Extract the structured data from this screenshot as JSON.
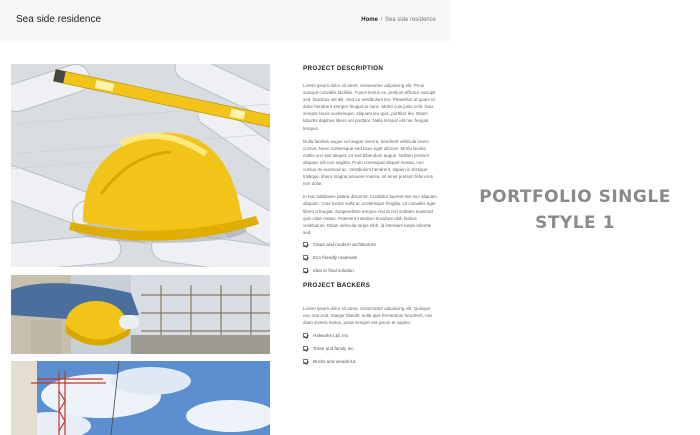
{
  "header": {
    "title": "Sea side residence",
    "breadcrumb": {
      "home": "Home",
      "separator": "/",
      "current": "Sea side residence"
    }
  },
  "images": [
    {
      "name": "hard-hat-on-blueprints-image"
    },
    {
      "name": "worker-holding-hard-hat-image"
    },
    {
      "name": "construction-crane-image"
    }
  ],
  "project_description": {
    "heading": "PROJECT DESCRIPTION",
    "paragraphs": [
      "Lorem ipsum dolor sit amet, consectetur adipiscing elit. Proin suscipit convallis facilisis. Fusce lectus ex, pretium efficitur suscipit sed, faucibus vel elit. Sed eu vestibulum leo. Phasellus at quam id dolor hendrerit semper feugiat at nunc. Morbi cuis justo velit. Duis semper lacus scelerisque, aliquam leo quis, porttitor leo. Etiam lobortis dapibus libero vel porttitor. Nulla tempor elit nec feugiat tempus.",
      "Nulla facilisis augue vel augue viverra, hendrerit vehicula lorem cursus. Nunc scelerisque sed risus eget ultrices. Morbi lacinia mollis orci sed aliquet. Ut sed bibendum augue. Nullam pretium aliquam elit non sagittis. Proin consequat aliquet massa, non cursus mi euismod ac. Vestibulum hendrerit, sapien in tristique tristique, libero magna posuere massa, sit amet pretium felis eros non dolor.",
      "In hac habitasse platea dictumst. Curabitur laoreet nisi nec aliquam aliquam. Cras luctus nulla ac scelerisque fringilla. Ut convallis eget libero a feugiat. Suspendisse tempus nisl at nisl sodales euismod quis vitae metus. Praesent interdum tincidunt nibh finibus vestibulum. Etiam vehicula turpis nibh, id interdum turpis lobortis sed."
    ],
    "features": [
      "Clean and modern architecture",
      "Eco friendly materials",
      "Idea to final solution"
    ]
  },
  "project_backers": {
    "heading": "PROJECT BACKERS",
    "paragraph": "Lorem ipsum dolor sit amet, consectetur adipiscing elit. Quisque nec erat erat. Integer blandit, nulla quis fermentum hendrerit, nisi diam viverra metus, porta semper est ipsum et sapien.",
    "backers": [
      "Halworks Ltd, Inc.",
      "Tores and family inc.",
      "Bricks and woods ltd."
    ]
  },
  "side_label": {
    "line1": "PORTFOLIO SINGLE",
    "line2": "STYLE 1"
  },
  "colors": {
    "accent_yellow": "#f2c41a",
    "title_bar": "#f7f7f7",
    "label_gray": "#8a8a8a"
  }
}
